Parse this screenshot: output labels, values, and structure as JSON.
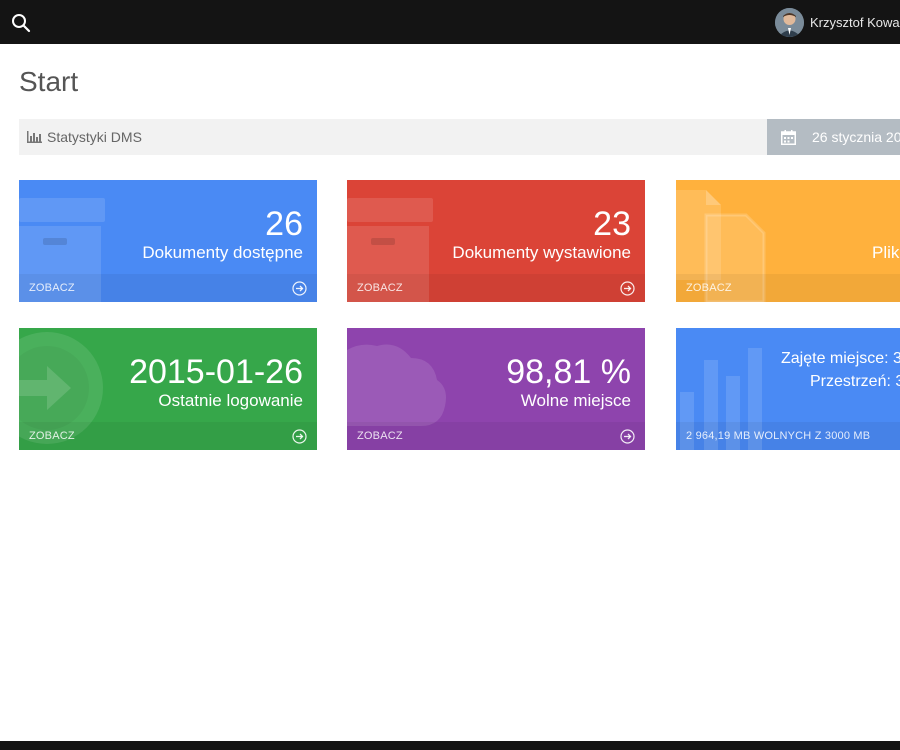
{
  "header": {
    "user_name": "Krzysztof Kowal"
  },
  "page": {
    "title": "Start"
  },
  "stats": {
    "label": "Statystyki DMS",
    "date": "26 stycznia 20"
  },
  "tiles": [
    {
      "value": "26",
      "label": "Dokumenty dostępne",
      "footer": "ZOBACZ",
      "color": "#4a8af4"
    },
    {
      "value": "23",
      "label": "Dokumenty wystawione",
      "footer": "ZOBACZ",
      "color": "#db4437"
    },
    {
      "value": "",
      "label": "Pliki",
      "footer": "ZOBACZ",
      "color": "#ffb13d"
    },
    {
      "value": "2015-01-26",
      "label": "Ostatnie logowanie",
      "footer": "ZOBACZ",
      "color": "#36a74a"
    },
    {
      "value": "98,81 %",
      "label": "Wolne miejsce",
      "footer": "ZOBACZ",
      "color": "#8e44ad"
    }
  ],
  "storage": {
    "line1": "Zajęte miejsce: 3",
    "line2": "Przestrzeń: 3",
    "footer": "2 964,19 MB WOLNYCH Z 3000 MB",
    "color": "#4a8af4"
  },
  "icons": {
    "search": "search-icon",
    "stats": "bar-chart-icon",
    "calendar": "calendar-icon",
    "arrow": "arrow-circle-right-icon",
    "archive": "archive-box-icon",
    "files": "files-icon",
    "login": "login-arrow-icon",
    "cloud": "cloud-icon",
    "chart": "bar-chart-icon"
  }
}
